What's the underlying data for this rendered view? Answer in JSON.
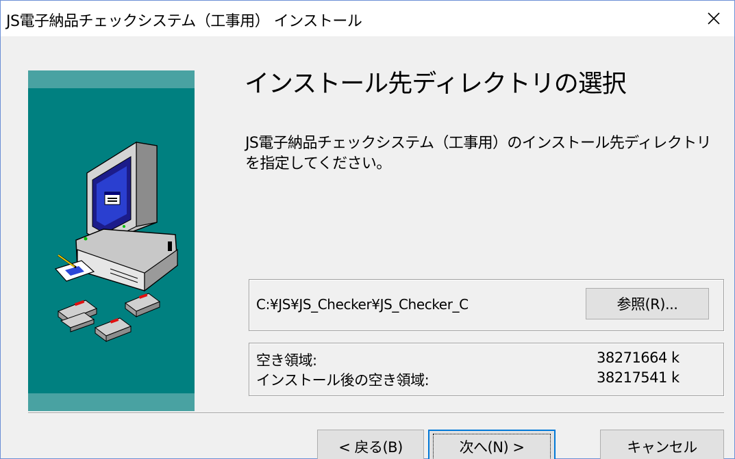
{
  "window": {
    "title": "JS電子納品チェックシステム（工事用） インストール",
    "close_icon": "close-icon"
  },
  "page": {
    "heading": "インストール先ディレクトリの選択",
    "description": "JS電子納品チェックシステム（工事用）のインストール先ディレクトリを指定してください。"
  },
  "directory": {
    "path": "C:¥JS¥JS_Checker¥JS_Checker_C",
    "browse_label": "参照(R)..."
  },
  "space": {
    "free_label": "空き領域:",
    "free_value": "38271664 k",
    "after_label": "インストール後の空き領域:",
    "after_value": "38217541 k"
  },
  "buttons": {
    "back": "< 戻る(B)",
    "next": "次へ(N) >",
    "cancel": "キャンセル"
  },
  "colors": {
    "panel_bg": "#008080",
    "panel_band": "#49a2a2",
    "focus_border": "#0078d7"
  }
}
